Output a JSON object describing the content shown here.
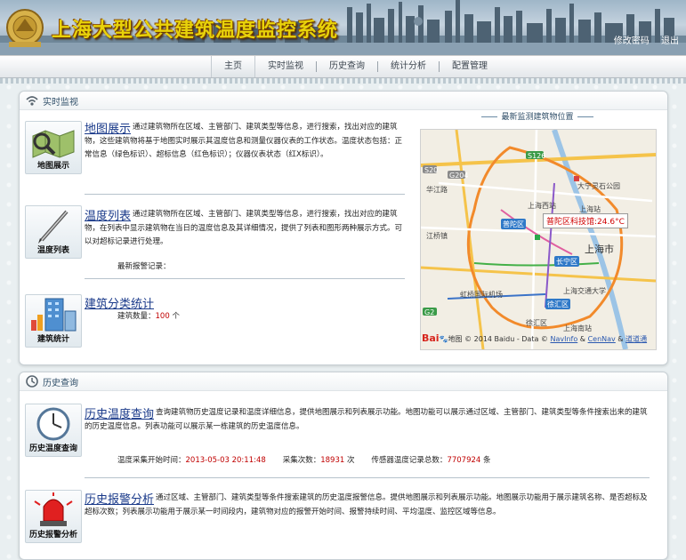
{
  "header": {
    "title": "上海大型公共建筑温度监控系统",
    "links": {
      "change_password": "修改密码",
      "logout": "退出"
    }
  },
  "nav": {
    "items": [
      {
        "label": "主页",
        "active": true
      },
      {
        "label": "实时监视"
      },
      {
        "label": "历史查询"
      },
      {
        "label": "统计分析"
      },
      {
        "label": "配置管理"
      }
    ]
  },
  "realtime": {
    "title": "实时监视",
    "map_show": {
      "icon_label": "地图展示",
      "title": "地图展示",
      "desc": "通过建筑物所在区域、主管部门、建筑类型等信息，进行搜索，找出对应的建筑物，这些建筑物将基于地图实时展示其温度信息和测量仪器仪表的工作状态。温度状态包括：正常信息（绿色标识）、超标信息（红色标识）；仪器仪表状态（红X标识）。"
    },
    "temp_list": {
      "icon_label": "温度列表",
      "title": "温度列表",
      "desc": "通过建筑物所在区域、主管部门、建筑类型等信息，进行搜索，找出对应的建筑物，在列表中显示建筑物在当日的温度信息及其详细情况，提供了列表和图形两种展示方式。可以对超标记录进行处理。",
      "latest_alarm_label": "最新报警记录："
    },
    "building_stats": {
      "icon_label": "建筑统计",
      "title": "建筑分类统计",
      "count_label": "建筑数量：",
      "count_value": "100",
      "count_unit": "个"
    },
    "map": {
      "title": "最新监测建筑物位置",
      "tooltip": "普陀区科技馆:24.6°C",
      "labels": [
        "普陀区",
        "长宁区",
        "徐汇区",
        "上海市",
        "上海西站",
        "大宁灵石公园",
        "上海站",
        "虹桥国际机场",
        "江桥镇",
        "上海交通大学",
        "华江路",
        "G204",
        "S126",
        "S20",
        "G2",
        "上海南站",
        "徐汇区"
      ],
      "copyright_logo": "Bai",
      "copyright_logo2": "地图",
      "copyright": "© 2014 Baidu - Data ©",
      "links": [
        "NavInfo",
        "CenNav",
        "道道通"
      ]
    }
  },
  "history": {
    "title": "历史查询",
    "temp_query": {
      "icon_label": "历史温度查询",
      "title": "历史温度查询",
      "desc": "查询建筑物历史温度记录和温度详细信息，提供地图展示和列表展示功能。地图功能可以展示通过区域、主管部门、建筑类型等条件搜索出来的建筑的历史温度信息。列表功能可以展示某一栋建筑的历史温度信息。",
      "start_time_label": "温度采集开始时间：",
      "start_time_value": "2013-05-03 20:11:48",
      "collect_count_label": "采集次数：",
      "collect_count_value": "18931",
      "collect_count_unit": "次",
      "sensor_total_label": "传感器温度记录总数：",
      "sensor_total_value": "7707924",
      "sensor_total_unit": "条"
    },
    "alarm_analysis": {
      "icon_label": "历史报警分析",
      "title": "历史报警分析",
      "desc": "通过区域、主管部门、建筑类型等条件搜索建筑的历史温度报警信息。提供地图展示和列表展示功能。地图展示功能用于展示建筑名称、是否超标及超标次数；列表展示功能用于展示某一时间段内，建筑物对应的报警开始时间、报警持续时间、平均温度、监控区域等信息。"
    }
  }
}
